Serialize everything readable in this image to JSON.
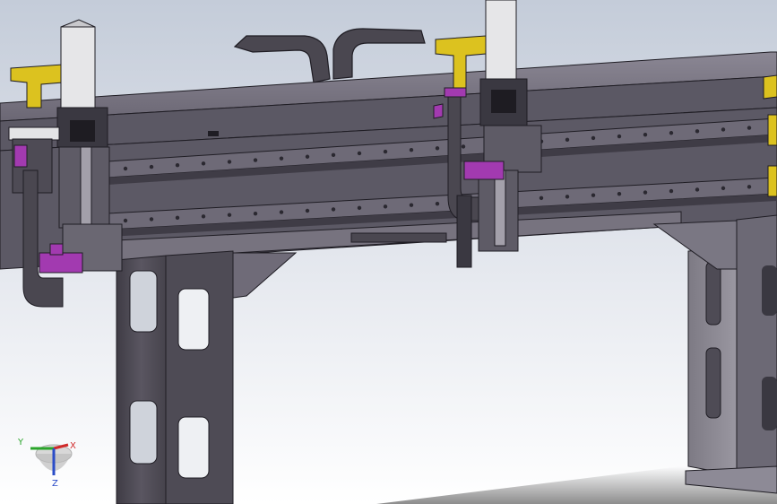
{
  "viewport": {
    "background_top": "#c4ccd9",
    "background_bottom": "#ffffff"
  },
  "colors": {
    "steel_dark": "#4e4b55",
    "steel_mid": "#6f6b78",
    "steel_light": "#8f8b98",
    "edge": "#1f1d24",
    "carriage_light": "#e4e4e6",
    "accent_purple": "#a23ab0",
    "accent_yellow": "#dcc21f",
    "cable_chain": "#4a4750"
  },
  "triad": {
    "x_label": "X",
    "y_label": "Y",
    "z_label": "Z",
    "x_color": "#d02a2a",
    "y_color": "#2aa52a",
    "z_color": "#2a4cc8"
  }
}
